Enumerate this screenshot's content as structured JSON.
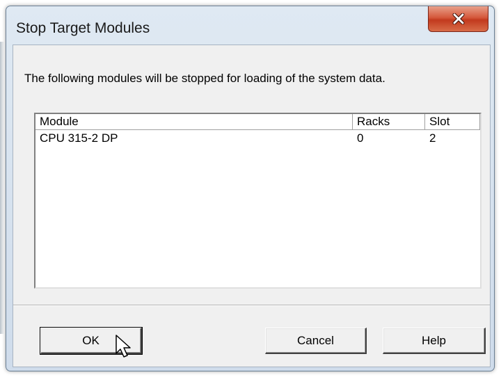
{
  "dialog": {
    "title": "Stop Target Modules",
    "message": "The following modules will be stopped for loading of the system data.",
    "close_icon": "close-icon"
  },
  "table": {
    "columns": [
      "Module",
      "Racks",
      "Slot"
    ],
    "rows": [
      {
        "module": "CPU 315-2 DP",
        "racks": "0",
        "slot": "2"
      }
    ]
  },
  "buttons": {
    "ok": "OK",
    "cancel": "Cancel",
    "help": "Help"
  }
}
